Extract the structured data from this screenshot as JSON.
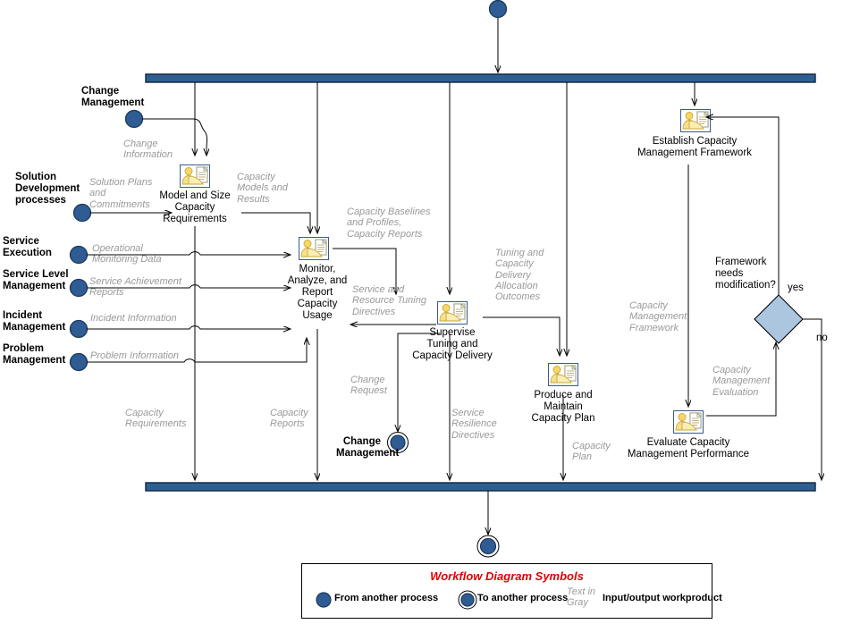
{
  "diagram": {
    "title": "Capacity Management Workflow Diagram",
    "colors": {
      "bar_fill": "#2e5f91",
      "bar_border": "#12243d",
      "node_fill": "#2f5c92",
      "node_border": "#1b3a5c",
      "decision_fill": "#adc6e0",
      "decision_border": "#000000",
      "workproduct_text": "#999999",
      "legend_title": "#e00000",
      "icon_person": "#f5d76e",
      "icon_border": "#3a5a8c",
      "line": "#000000"
    },
    "start_node": {
      "name": "start-node"
    },
    "end_node": {
      "name": "end-node"
    }
  },
  "actors": [
    {
      "id": "change-management-top",
      "label": "Change\nManagement"
    },
    {
      "id": "solution-development",
      "label": "Solution\nDevelopment\nprocesses"
    },
    {
      "id": "service-execution",
      "label": "Service\nExecution"
    },
    {
      "id": "service-level-management",
      "label": "Service Level\nManagement"
    },
    {
      "id": "incident-management",
      "label": "Incident\nManagement"
    },
    {
      "id": "problem-management",
      "label": "Problem\nManagement"
    },
    {
      "id": "change-management-end",
      "label": "Change\nManagement"
    }
  ],
  "activities": [
    {
      "id": "model-and-size",
      "label": "Model and Size\nCapacity\nRequirements"
    },
    {
      "id": "monitor-analyze-report",
      "label": "Monitor,\nAnalyze, and\nReport\nCapacity\nUsage"
    },
    {
      "id": "supervise-tuning",
      "label": "Supervise\nTuning and\nCapacity Delivery"
    },
    {
      "id": "produce-maintain-plan",
      "label": "Produce and\nMaintain\nCapacity Plan"
    },
    {
      "id": "establish-framework",
      "label": "Establish Capacity\nManagement Framework"
    },
    {
      "id": "evaluate-performance",
      "label": "Evaluate Capacity\nManagement Performance"
    }
  ],
  "workproducts": [
    {
      "id": "change-information",
      "label": "Change\nInformation"
    },
    {
      "id": "solution-plans",
      "label": "Solution Plans\nand\nCommitments"
    },
    {
      "id": "capacity-models-results",
      "label": "Capacity\nModels and\nResults"
    },
    {
      "id": "operational-monitoring-data",
      "label": "Operational\nMonitoring Data"
    },
    {
      "id": "service-achievement-reports",
      "label": "Service Achievement\nReports"
    },
    {
      "id": "incident-information",
      "label": "Incident Information"
    },
    {
      "id": "problem-information",
      "label": "Problem Information"
    },
    {
      "id": "capacity-baselines-profiles",
      "label": "Capacity Baselines\nand Profiles,\nCapacity Reports"
    },
    {
      "id": "service-resource-tuning-directives",
      "label": "Service and\nResource Tuning\nDirectives"
    },
    {
      "id": "tuning-capacity-delivery-outcomes",
      "label": "Tuning and\nCapacity\nDelivery\nAllocation\nOutcomes"
    },
    {
      "id": "capacity-requirements",
      "label": "Capacity\nRequirements"
    },
    {
      "id": "capacity-reports",
      "label": "Capacity\nReports"
    },
    {
      "id": "change-request",
      "label": "Change\nRequest"
    },
    {
      "id": "service-resilience-directives",
      "label": "Service\nResilience\nDirectives"
    },
    {
      "id": "capacity-plan",
      "label": "Capacity\nPlan"
    },
    {
      "id": "capacity-management-framework",
      "label": "Capacity\nManagement\nFramework"
    },
    {
      "id": "capacity-management-evaluation",
      "label": "Capacity\nManagement\nEvaluation"
    }
  ],
  "decision": {
    "id": "framework-needs-modification",
    "question": "Framework\nneeds\nmodification?",
    "branch_yes": "yes",
    "branch_no": "no"
  },
  "legend": {
    "title": "Workflow Diagram Symbols",
    "item_from": "From another process",
    "item_to": "To another process",
    "gray_text": "Text in\nGray",
    "item_workproduct": "Input/output workproduct"
  }
}
